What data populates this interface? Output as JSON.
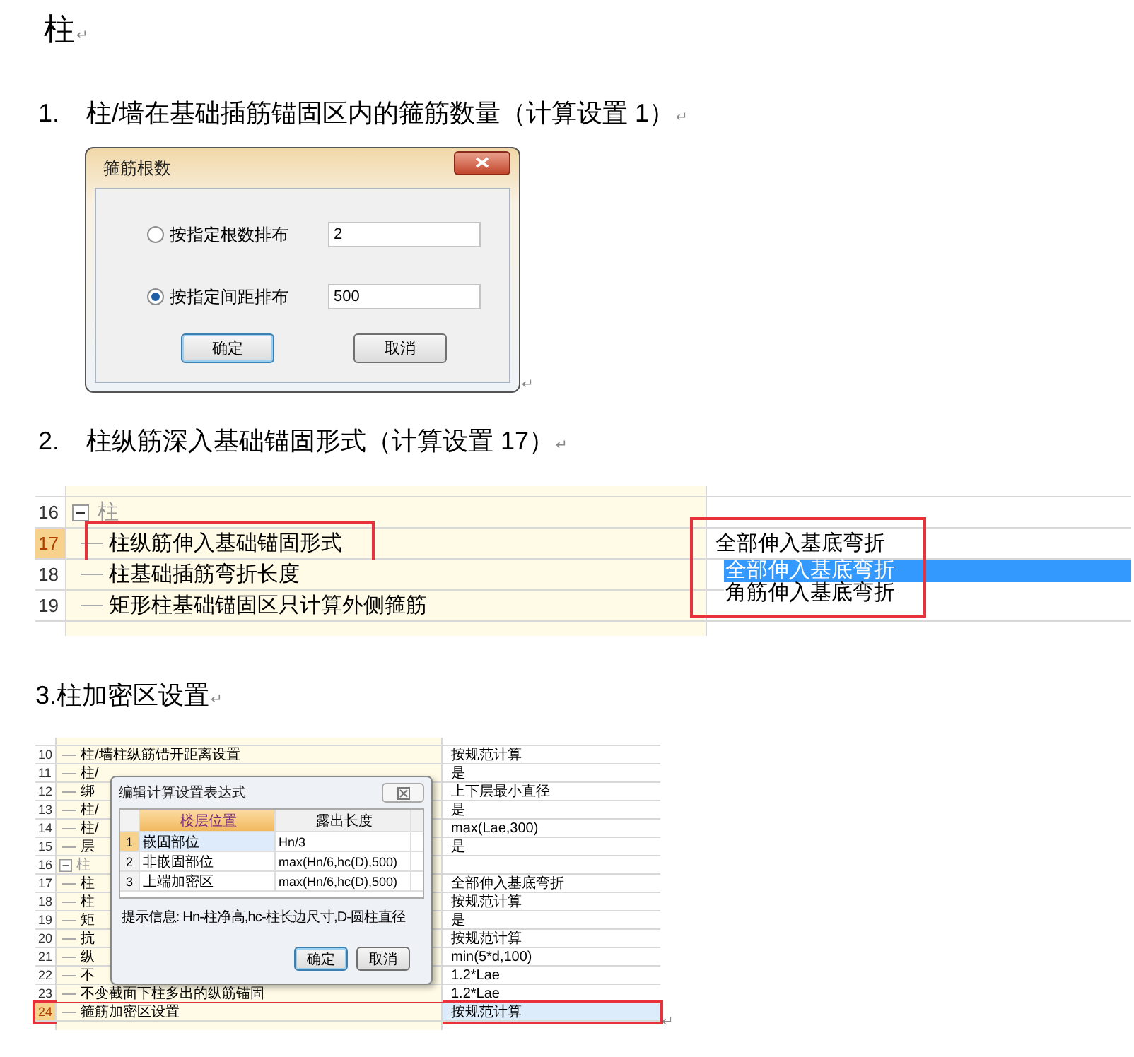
{
  "heading": {
    "text": "柱",
    "mark": "↵"
  },
  "item_1": {
    "number": "1.",
    "title": "柱/墙在基础插筋锚固区内的箍筋数量（计算设置 1）",
    "mark": "↵"
  },
  "dialog_1": {
    "title": "箍筋根数",
    "options": [
      {
        "label": "按指定根数排布",
        "value": "2",
        "selected": false
      },
      {
        "label": "按指定间距排布",
        "value": "500",
        "selected": true
      }
    ],
    "buttons": [
      {
        "label": "确定",
        "default": true
      },
      {
        "label": "取消",
        "default": false
      }
    ],
    "mark": "↵"
  },
  "item_2": {
    "number": "2.",
    "title": "柱纵筋深入基础锚固形式（计算设置 17）",
    "mark": "↵"
  },
  "grid_1": {
    "rows": [
      {
        "kind": "group",
        "number": "16",
        "name": "柱",
        "selected": false,
        "highlighted": false
      },
      {
        "kind": "item",
        "number": "17",
        "name": "柱纵筋伸入基础锚固形式",
        "selected": true,
        "highlighted": true
      },
      {
        "kind": "item",
        "number": "18",
        "name": "柱基础插筋弯折长度",
        "selected": false,
        "highlighted": false
      },
      {
        "kind": "item",
        "number": "19",
        "name": "矩形柱基础锚固区只计算外侧箍筋",
        "selected": false,
        "highlighted": false
      }
    ],
    "editor": {
      "value": "全部伸入基底弯折",
      "highlighted": true,
      "options": [
        {
          "label": "全部伸入基底弯折",
          "selected": true
        },
        {
          "label": "角筋伸入基底弯折",
          "selected": false
        }
      ]
    }
  },
  "item_3": {
    "number": "3.",
    "title": "柱加密区设置",
    "mark": "↵"
  },
  "grid_2": {
    "rows": [
      {
        "kind": "item",
        "number": "10",
        "name": "柱/墙柱纵筋错开距离设置",
        "value": "按规范计算",
        "selected": false,
        "highlighted": false
      },
      {
        "kind": "item",
        "number": "11",
        "name": "柱/",
        "value": "是",
        "selected": false,
        "highlighted": false
      },
      {
        "kind": "item",
        "number": "12",
        "name": "绑",
        "value": "上下层最小直径",
        "selected": false,
        "highlighted": false
      },
      {
        "kind": "item",
        "number": "13",
        "name": "柱/",
        "value": "是",
        "selected": false,
        "highlighted": false
      },
      {
        "kind": "item",
        "number": "14",
        "name": "柱/",
        "value": "max(Lae,300)",
        "selected": false,
        "highlighted": false
      },
      {
        "kind": "item",
        "number": "15",
        "name": "层",
        "value": "是",
        "selected": false,
        "highlighted": false
      },
      {
        "kind": "group",
        "number": "16",
        "name": "柱",
        "selected": false,
        "highlighted": false
      },
      {
        "kind": "item",
        "number": "17",
        "name": "柱",
        "value": "全部伸入基底弯折",
        "selected": false,
        "highlighted": false
      },
      {
        "kind": "item",
        "number": "18",
        "name": "柱",
        "value": "按规范计算",
        "selected": false,
        "highlighted": false
      },
      {
        "kind": "item",
        "number": "19",
        "name": "矩",
        "value": "是",
        "selected": false,
        "highlighted": false
      },
      {
        "kind": "item",
        "number": "20",
        "name": "抗",
        "value": "按规范计算",
        "selected": false,
        "highlighted": false
      },
      {
        "kind": "item",
        "number": "21",
        "name": "纵",
        "value": "min(5*d,100)",
        "selected": false,
        "highlighted": false
      },
      {
        "kind": "item",
        "number": "22",
        "name": "不",
        "value": "1.2*Lae",
        "selected": false,
        "highlighted": false
      },
      {
        "kind": "item",
        "number": "23",
        "name": "不变截面下柱多出的纵筋锚固",
        "value": "1.2*Lae",
        "selected": false,
        "highlighted": false
      },
      {
        "kind": "item",
        "number": "24",
        "name": "箍筋加密区设置",
        "value": "按规范计算",
        "selected": true,
        "highlighted": true
      }
    ],
    "dialog": {
      "title": "编辑计算设置表达式",
      "columns": [
        "楼层位置",
        "露出长度"
      ],
      "rows": [
        {
          "number": "1",
          "position": "嵌固部位",
          "length": "Hn/3",
          "selected": true
        },
        {
          "number": "2",
          "position": "非嵌固部位",
          "length": "max(Hn/6,hc(D),500)",
          "selected": false
        },
        {
          "number": "3",
          "position": "上端加密区",
          "length": "max(Hn/6,hc(D),500)",
          "selected": false
        }
      ],
      "hint": "提示信息: Hn-柱净高,hc-柱长边尺寸,D-圆柱直径",
      "buttons": [
        {
          "label": "确定",
          "default": true
        },
        {
          "label": "取消",
          "default": false
        }
      ]
    },
    "mark": "↵"
  }
}
